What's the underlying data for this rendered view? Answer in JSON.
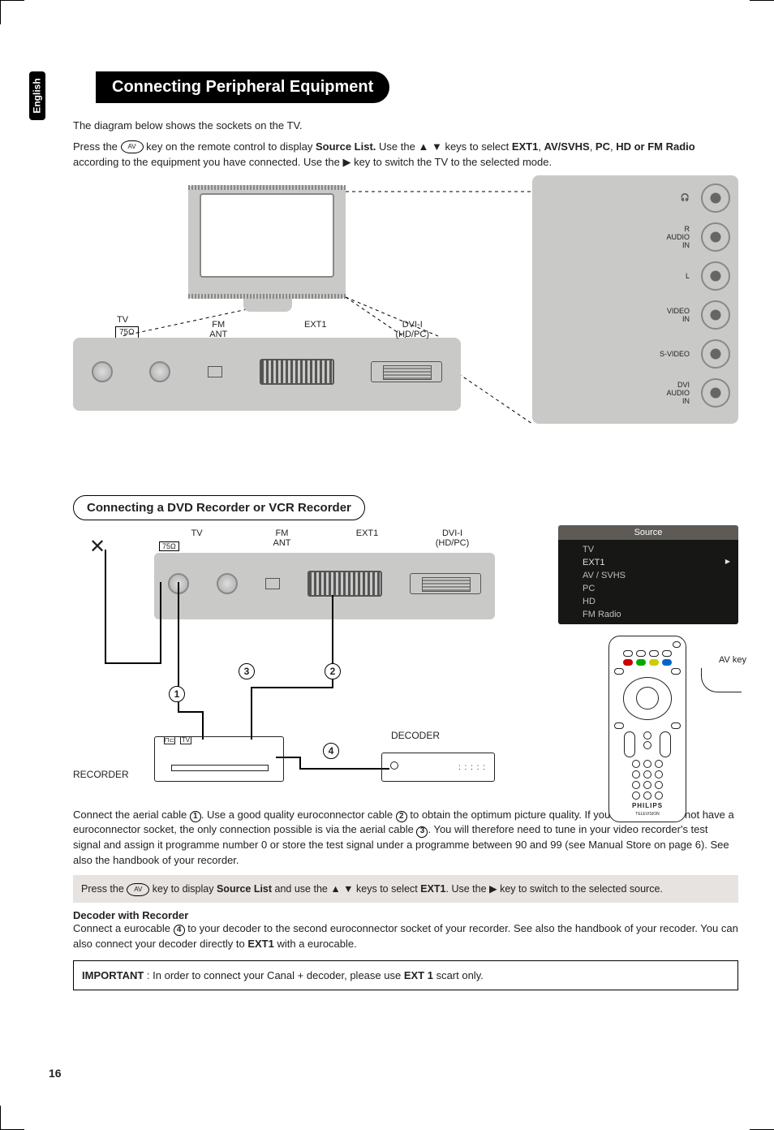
{
  "lang_tab": "English",
  "title": "Connecting Peripheral Equipment",
  "intro_line1": "The diagram below shows the sockets on the TV.",
  "intro_part1": "Press the ",
  "av_label": "AV",
  "intro_part2": " key on the remote control to display ",
  "source_list_bold": "Source List.",
  "intro_part3": " Use the ",
  "arrows_ud": "▲ ▼",
  "intro_part4": " keys  to select ",
  "ext1_bold": "EXT1",
  "intro_part5": ", ",
  "modes_bold": "AV/SVHS",
  "intro_part6": ", ",
  "modes_bold2": "PC",
  "intro_part7": ", ",
  "modes_bold3": "HD or FM Radio",
  "intro_part8": " according to the equipment you have connected. Use the ",
  "arrow_r": "▶",
  "intro_part9": " key to switch the TV to the selected mode.",
  "back_labels": {
    "tv": "TV",
    "tvbox": "75Ω",
    "fm": "FM\nANT",
    "ext1": "EXT1",
    "dvi": "DVI-I\n(HD/PC)"
  },
  "side_labels": {
    "hp": "🎧",
    "audio_r": "R",
    "audio": "AUDIO\nIN",
    "audio_l": "L",
    "video": "VIDEO\nIN",
    "svideo": "S-VIDEO",
    "dvi_audio": "DVI\nAUDIO\nIN"
  },
  "sub_heading": "Connecting a DVD Recorder or VCR Recorder",
  "back2": {
    "tv": "TV",
    "tvbox": "75Ω",
    "fm": "FM\nANT",
    "ext1": "EXT1",
    "dvi": "DVI-I\n(HD/PC)"
  },
  "circ": {
    "c1": "1",
    "c2": "2",
    "c3": "3",
    "c4": "4"
  },
  "rec_label": "RECORDER",
  "rec_tv": "TV",
  "dec_label": "DECODER",
  "source_menu": {
    "title": "Source",
    "items": [
      "TV",
      "EXT1",
      "AV / SVHS",
      "PC",
      "HD",
      "FM Radio"
    ],
    "selected_index": 1
  },
  "av_key_callout": "AV key",
  "remote_logo": "PHILIPS",
  "remote_sub": "TELEVISION",
  "para1_a": "Connect the aerial cable ",
  "para1_b": ". Use a good quality euroconnector cable ",
  "para1_c": " to obtain the optimum picture quality. If your recorder does not have a euroconnector socket, the only connection possible is via the aerial cable ",
  "para1_d": ".  You will therefore need to tune in your video recorder's test signal and assign it programme number 0 or store the test signal under a programme between 90 and 99 (see Manual Store on page 6). See also the handbook of your recorder.",
  "tip_a": "Press the ",
  "tip_b": " key to display ",
  "tip_c": " and use the ",
  "tip_d": " keys to select ",
  "tip_e": ". Use the ",
  "tip_f": " key to switch to the selected source.",
  "tip_source_list": "Source List",
  "decoder_head": "Decoder with Recorder",
  "decoder_para_a": "Connect a eurocable ",
  "decoder_para_b": " to your decoder to the second euroconnector socket of your recorder. See also the handbook of your recoder. You can also connect your decoder directly to ",
  "decoder_para_c": " with a eurocable.",
  "imp_bold": "IMPORTANT",
  "imp_rest": " : In order to connect your Canal + decoder, please use ",
  "imp_ext1": "EXT 1",
  "imp_tail": " scart only.",
  "page_num": "16"
}
